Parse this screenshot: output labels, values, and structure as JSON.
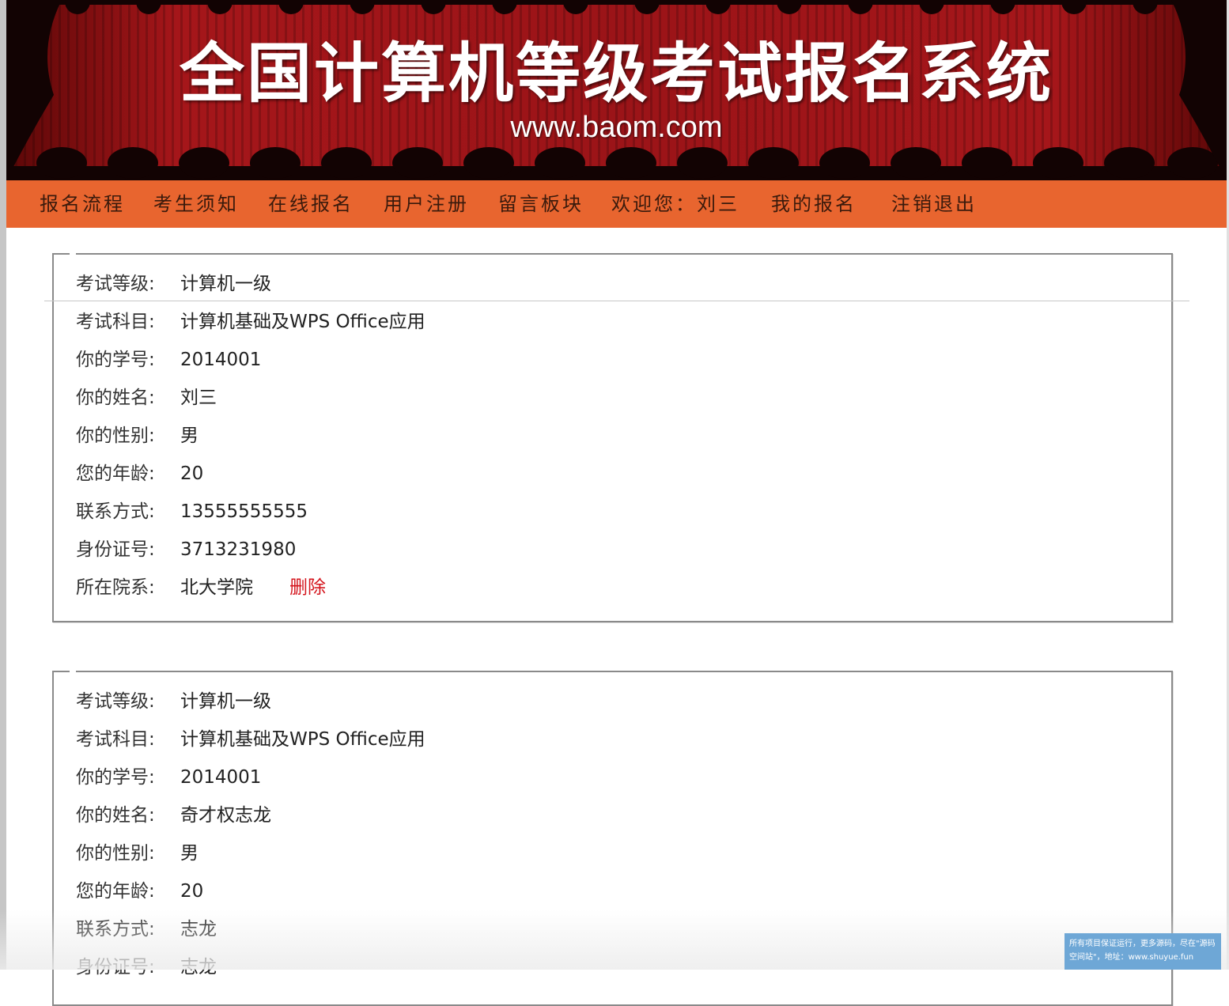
{
  "banner": {
    "title": "全国计算机等级考试报名系统",
    "url": "www.baom.com"
  },
  "nav": {
    "items": [
      {
        "label": "报名流程",
        "name": "nav-item-process"
      },
      {
        "label": "考生须知",
        "name": "nav-item-notice"
      },
      {
        "label": "在线报名",
        "name": "nav-item-online-register"
      },
      {
        "label": "用户注册",
        "name": "nav-item-user-signup"
      },
      {
        "label": "留言板块",
        "name": "nav-item-message-board"
      },
      {
        "label": "欢迎您：刘三",
        "name": "nav-item-welcome"
      },
      {
        "label": "我的报名",
        "name": "nav-item-my-registrations"
      },
      {
        "label": "注销退出",
        "name": "nav-item-logout"
      }
    ]
  },
  "labels": {
    "level": "考试等级:",
    "subject": "考试科目:",
    "student_id": "你的学号:",
    "name": "你的姓名:",
    "gender": "你的性别:",
    "age": "您的年龄:",
    "contact": "联系方式:",
    "id_card": "身份证号:",
    "department": "所在院系:"
  },
  "actions": {
    "delete": "删除"
  },
  "registrations": [
    {
      "level": "计算机一级",
      "subject": "计算机基础及WPS Office应用",
      "student_id": "2014001",
      "name": "刘三",
      "gender": "男",
      "age": "20",
      "contact": "13555555555",
      "id_card": "3713231980",
      "department": "北大学院"
    },
    {
      "level": "计算机一级",
      "subject": "计算机基础及WPS Office应用",
      "student_id": "2014001",
      "name": "奇才权志龙",
      "gender": "男",
      "age": "20",
      "contact": "志龙",
      "id_card": "志龙"
    }
  ],
  "watermark": {
    "text": "所有项目保证运行，更多源码，尽在\"源码空间站\"，地址：www.shuyue.fun"
  }
}
